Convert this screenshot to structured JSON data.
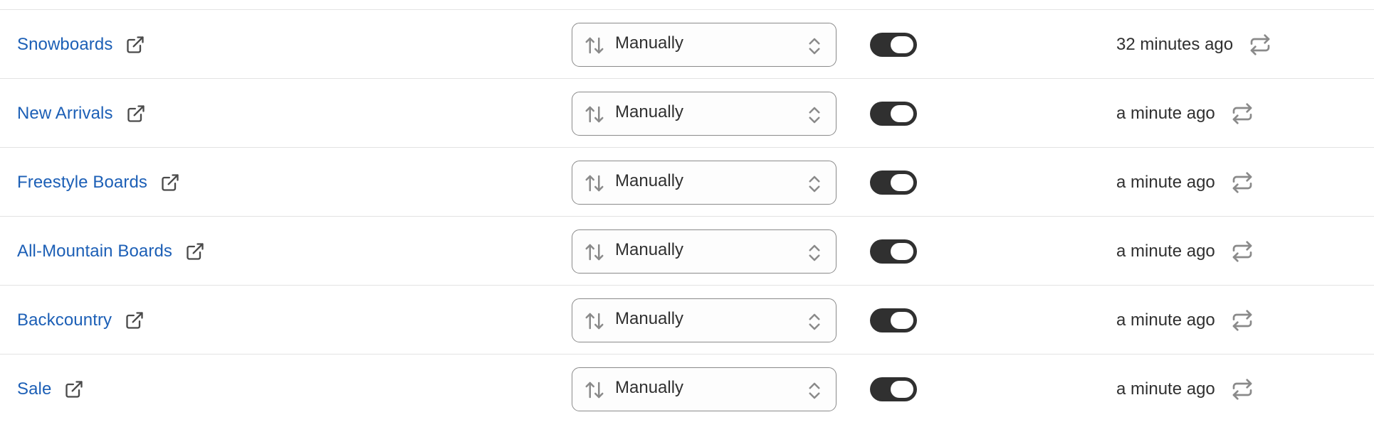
{
  "collections": [
    {
      "name": "Snowboards",
      "sort_label": "Manually",
      "enabled": true,
      "updated": "32 minutes ago"
    },
    {
      "name": "New Arrivals",
      "sort_label": "Manually",
      "enabled": true,
      "updated": "a minute ago"
    },
    {
      "name": "Freestyle Boards",
      "sort_label": "Manually",
      "enabled": true,
      "updated": "a minute ago"
    },
    {
      "name": "All-Mountain Boards",
      "sort_label": "Manually",
      "enabled": true,
      "updated": "a minute ago"
    },
    {
      "name": "Backcountry",
      "sort_label": "Manually",
      "enabled": true,
      "updated": "a minute ago"
    },
    {
      "name": "Sale",
      "sort_label": "Manually",
      "enabled": true,
      "updated": "a minute ago"
    }
  ],
  "icons": {
    "external": "external-link-icon",
    "sort": "sort-arrows-icon",
    "chevron": "chevron-up-down-icon",
    "sync": "sync-icon"
  },
  "colors": {
    "link": "#1c5fb6",
    "text": "#303030",
    "toggle_on": "#303030",
    "icon_gray": "#8a8a8a",
    "divider": "#e3e3e3"
  }
}
